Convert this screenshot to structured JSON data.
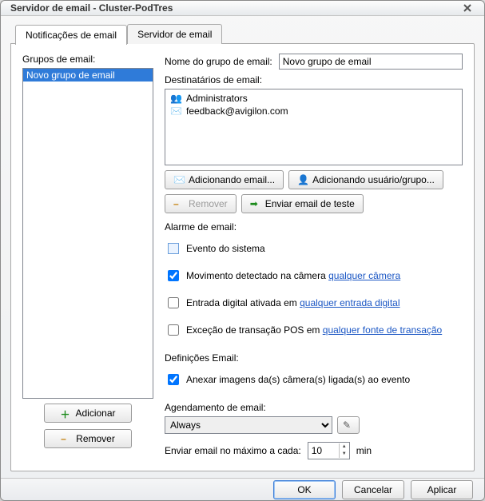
{
  "window": {
    "title": "Servidor de email - Cluster-PodTres"
  },
  "tabs": {
    "notifications": "Notificações de email",
    "server": "Servidor de email"
  },
  "left": {
    "groups_label": "Grupos de email:",
    "groups": [
      {
        "name": "Novo grupo de email",
        "selected": true
      }
    ],
    "add": "Adicionar",
    "remove": "Remover"
  },
  "name_row": {
    "label": "Nome do grupo de email:",
    "value": "Novo grupo de email"
  },
  "recipients": {
    "label": "Destinatários de email:",
    "items": [
      {
        "icon": "users",
        "text": "Administrators"
      },
      {
        "icon": "mail",
        "text": "feedback@avigilon.com"
      }
    ],
    "add_email": "Adicionando email...",
    "add_user": "Adicionando usuário/grupo...",
    "remove": "Remover",
    "send_test": "Enviar email de teste"
  },
  "alarm": {
    "heading": "Alarme de email:",
    "system_event": "Evento do sistema",
    "motion_prefix": "Movimento detectado na câmera ",
    "motion_link": "qualquer câmera",
    "digital_prefix": "Entrada digital ativada em ",
    "digital_link": "qualquer entrada digital",
    "pos_prefix": "Exceção de transação POS em ",
    "pos_link": "qualquer fonte de transação"
  },
  "defs": {
    "heading": "Definições Email:",
    "attach": "Anexar imagens da(s) câmera(s) ligada(s) ao evento"
  },
  "schedule": {
    "heading": "Agendamento de email:",
    "selected": "Always"
  },
  "throttle": {
    "label": "Enviar email no máximo a cada:",
    "value": "10",
    "unit": "min"
  },
  "footer": {
    "ok": "OK",
    "cancel": "Cancelar",
    "apply": "Aplicar"
  }
}
